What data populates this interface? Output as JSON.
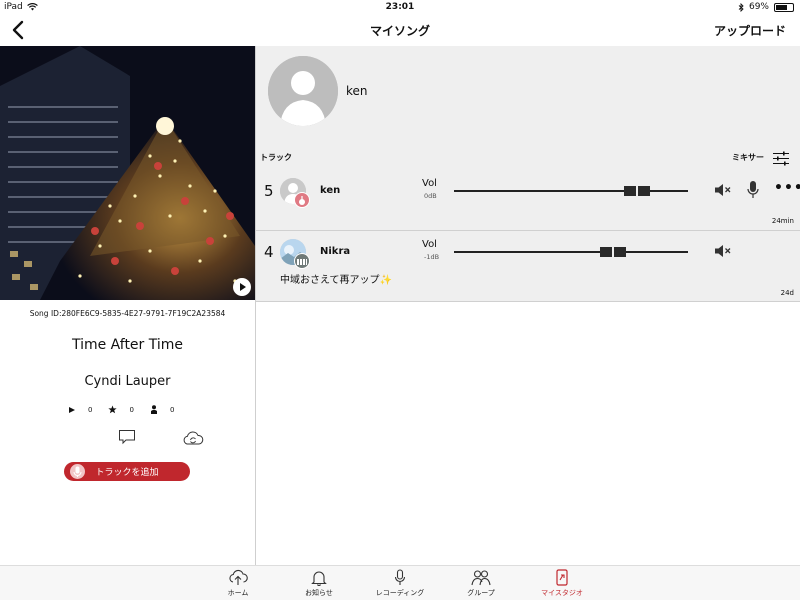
{
  "status_bar": {
    "device": "iPad",
    "time": "23:01",
    "battery": "69%",
    "battery_level": 0.69,
    "icons": [
      "wifi-icon",
      "bluetooth-icon",
      "battery-icon"
    ]
  },
  "nav": {
    "title": "マイソング",
    "upload_label": "アップロード",
    "back_icon": "chevron-left-icon"
  },
  "song": {
    "id_text": "Song ID:280FE6C9-5835-4E27-9791-7F19C2A23584",
    "title": "Time After Time",
    "artist": "Cyndi Lauper",
    "plays": "0",
    "stars": "0",
    "users": "0",
    "add_track_label": "トラックを追加"
  },
  "profile": {
    "name": "ken"
  },
  "tracks_header": {
    "label": "トラック",
    "mixer_label": "ミキサー"
  },
  "tracks": [
    {
      "number": "5",
      "name": "ken",
      "vol_label": "Vol",
      "db": "0dB",
      "volume_fraction": 0.78,
      "elapsed": "24min",
      "comment": ""
    },
    {
      "number": "4",
      "name": "Nikra",
      "vol_label": "Vol",
      "db": "-1dB",
      "volume_fraction": 0.68,
      "elapsed": "24d",
      "comment": "中域おさえて再アップ✨"
    }
  ],
  "tabs": [
    {
      "label": "ホーム",
      "icon": "cloud-upload-icon"
    },
    {
      "label": "お知らせ",
      "icon": "bell-icon"
    },
    {
      "label": "レコーディング",
      "icon": "microphone-icon"
    },
    {
      "label": "グループ",
      "icon": "group-icon"
    },
    {
      "label": "マイスタジオ",
      "icon": "studio-icon",
      "active": true
    }
  ],
  "colors": {
    "accent": "#c0272d",
    "panel": "#efefef"
  }
}
